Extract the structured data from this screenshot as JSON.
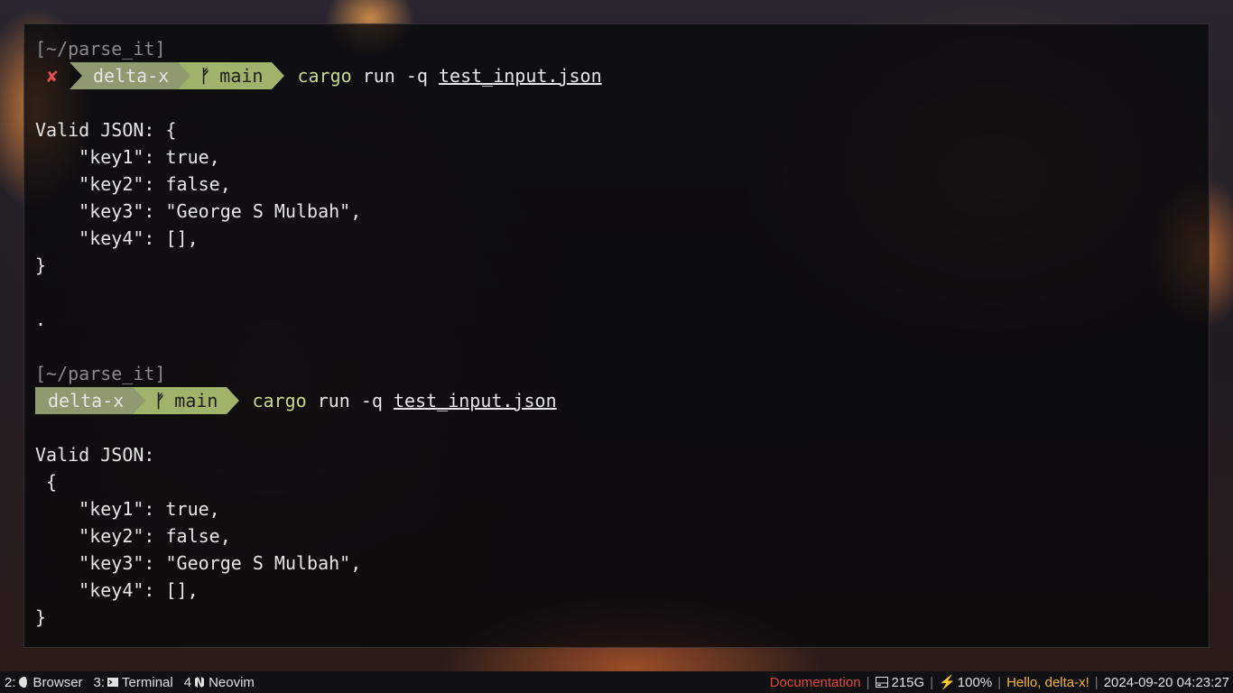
{
  "terminal": {
    "block1": {
      "cwd": "[~/parse_it]",
      "status_icon": "✘",
      "host": "delta-x",
      "branch_icon": "ᚠ",
      "branch": "main",
      "cmd_prog": "cargo",
      "cmd_args": " run -q ",
      "cmd_file": "test_input.json",
      "output": [
        "Valid JSON: {",
        "    \"key1\": true,",
        "    \"key2\": false,",
        "    \"key3\": \"George S Mulbah\",",
        "    \"key4\": [],",
        "}",
        "",
        "."
      ]
    },
    "block2": {
      "cwd": "[~/parse_it]",
      "host": "delta-x",
      "branch_icon": "ᚠ",
      "branch": "main",
      "cmd_prog": "cargo",
      "cmd_args": " run -q ",
      "cmd_file": "test_input.json",
      "output": [
        "Valid JSON:",
        " {",
        "    \"key1\": true,",
        "    \"key2\": false,",
        "    \"key3\": \"George S Mulbah\",",
        "    \"key4\": [],",
        "}"
      ]
    }
  },
  "taskbar": {
    "workspaces": [
      {
        "num": "2:",
        "icon": "browser-icon",
        "label": "Browser"
      },
      {
        "num": "3:",
        "icon": "terminal-icon",
        "label": "Terminal"
      },
      {
        "num": "4",
        "icon": "neovim-icon",
        "label": "Neovim"
      }
    ],
    "status": {
      "documentation": "Documentation",
      "disk": "215G",
      "battery": "100%",
      "greeting": "Hello, delta-x!",
      "datetime": "2024-09-20 04:23:27"
    }
  }
}
